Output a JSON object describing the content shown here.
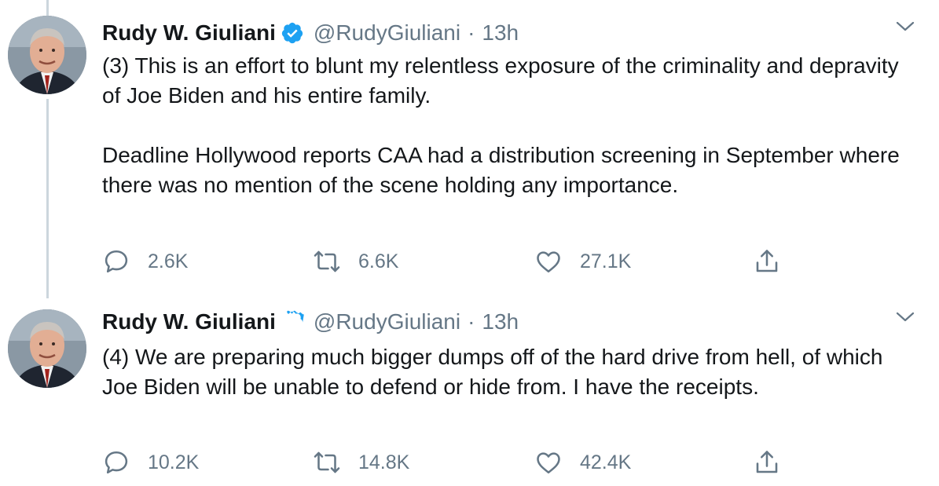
{
  "tweets": [
    {
      "author_name": "Rudy W. Giuliani",
      "handle": "@RudyGiuliani",
      "separator": "·",
      "time": "13h",
      "paragraphs": [
        "(3) This is an effort to blunt my relentless exposure of the criminality and depravity of Joe Biden and his entire family.",
        "Deadline Hollywood reports CAA had a distribution screening in September where there was no mention of the scene holding any importance."
      ],
      "replies": "2.6K",
      "retweets": "6.6K",
      "likes": "27.1K"
    },
    {
      "author_name": "Rudy W. Giuliani",
      "handle": "@RudyGiuliani",
      "separator": "·",
      "time": "13h",
      "paragraphs": [
        "(4) We are preparing much bigger dumps off of the hard drive from hell, of which Joe Biden will be unable to defend or hide from. I have the receipts."
      ],
      "replies": "10.2K",
      "retweets": "14.8K",
      "likes": "42.4K"
    }
  ],
  "icons": {
    "verified": "verified-badge-icon",
    "menu": "chevron-down-icon",
    "reply": "reply-icon",
    "retweet": "retweet-icon",
    "like": "heart-icon",
    "share": "share-icon"
  },
  "colors": {
    "text": "#14171a",
    "secondary": "#657786",
    "verified": "#1da1f2",
    "thread_line": "#ccd6dd"
  }
}
